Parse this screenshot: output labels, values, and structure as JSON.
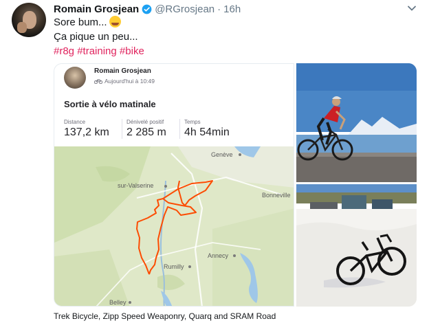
{
  "tweet": {
    "author_name": "Romain Grosjean",
    "handle": "@RGrosjean",
    "separator": "·",
    "time": "16h",
    "line1": "Sore bum...",
    "line2": "Ça pique un peu...",
    "hashtags": [
      "#r8g",
      "#training",
      "#bike"
    ],
    "colors": {
      "hashtag": "#e0245e",
      "verified": "#1da1f2"
    }
  },
  "strava": {
    "athlete": "Romain Grosjean",
    "timestamp": "Aujourd'hui à 10:49",
    "activity_title": "Sortie à vélo matinale",
    "stats": [
      {
        "label": "Distance",
        "value": "137,2 km"
      },
      {
        "label": "Dénivelé positif",
        "value": "2 285 m"
      },
      {
        "label": "Temps",
        "value": "4h 54min"
      }
    ],
    "map_labels": {
      "geneve": "Genève",
      "valserine": "sur-Valserine",
      "bonneville": "Bonneville",
      "annecy": "Annecy",
      "rumilly": "Rumilly",
      "belley": "Belley"
    },
    "route_color": "#fc4c02"
  },
  "caption": "Trek Bicycle, Zipp Speed Weaponry, Quarq and SRAM Road"
}
